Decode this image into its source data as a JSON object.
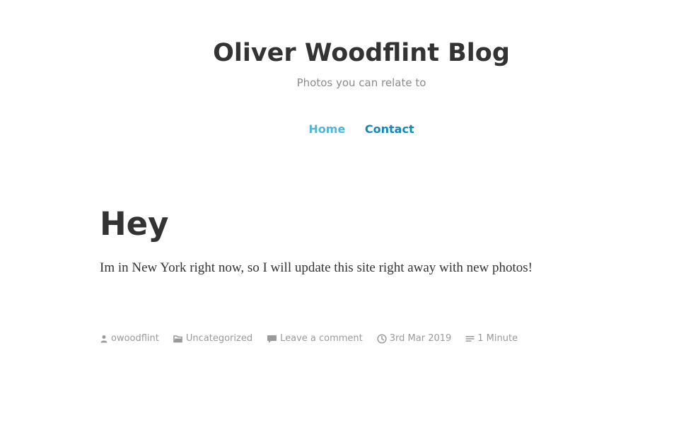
{
  "header": {
    "site_title": "Oliver Woodflint Blog",
    "tagline": "Photos you can relate to"
  },
  "nav": {
    "items": [
      {
        "label": "Home"
      },
      {
        "label": "Contact"
      }
    ]
  },
  "post": {
    "title": "Hey",
    "body": "Im in New York right now, so I will update this site right away with new photos!",
    "meta": {
      "author": "owoodflint",
      "category": "Uncategorized",
      "comments": "Leave a comment",
      "date": "3rd Mar 2019",
      "reading_time": "1 Minute"
    }
  },
  "colors": {
    "text": "#333333",
    "muted": "#9a9a9a",
    "nav_home": "#4ab8e0",
    "nav_contact": "#1288b8"
  },
  "icons": {
    "author": "person-icon",
    "category": "folder-icon",
    "comments": "speech-bubble-icon",
    "date": "clock-icon",
    "reading_time": "list-icon"
  }
}
